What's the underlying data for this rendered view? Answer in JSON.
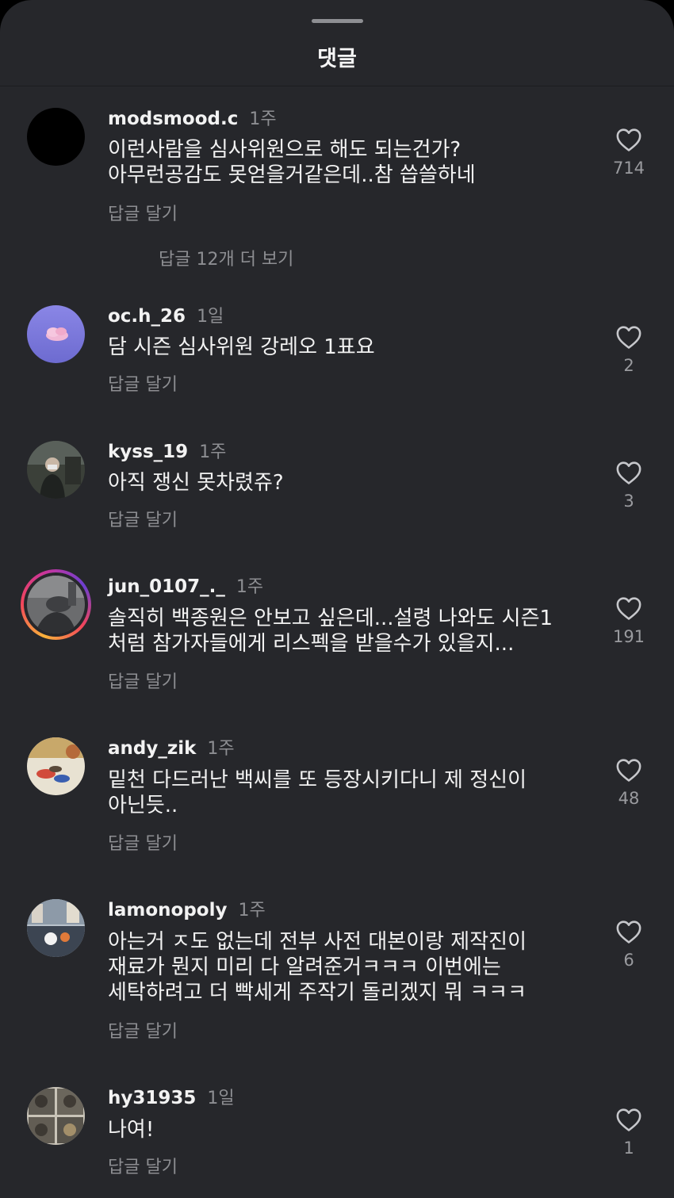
{
  "sheet": {
    "title": "댓글"
  },
  "comments": [
    {
      "username": "modsmood.c",
      "time": "1주",
      "text": "이런사람을 심사위원으로 해도 되는건가?\n아무런공감도 못얻을거같은데..참 씁쓸하네",
      "reply_label": "답글 달기",
      "likes": "714",
      "view_replies": "답글 12개 더 보기"
    },
    {
      "username": "oc.h_26",
      "time": "1일",
      "text": "담 시즌 심사위원 강레오 1표요",
      "reply_label": "답글 달기",
      "likes": "2"
    },
    {
      "username": "kyss_19",
      "time": "1주",
      "text": "아직 쟁신 못차렸쥬?",
      "reply_label": "답글 달기",
      "likes": "3"
    },
    {
      "username": "jun_0107_._",
      "time": "1주",
      "text": "솔직히 백종원은 안보고 싶은데...설령 나와도 시즌1\n처럼 참가자들에게 리스펙을 받을수가 있을지...",
      "reply_label": "답글 달기",
      "likes": "191"
    },
    {
      "username": "andy_zik",
      "time": "1주",
      "text": "밑천 다드러난 백씨를 또 등장시키다니 제 정신이\n아닌듯..",
      "reply_label": "답글 달기",
      "likes": "48"
    },
    {
      "username": "lamonopoly",
      "time": "1주",
      "text": "아는거 ㅈ도 없는데 전부 사전 대본이랑 제작진이\n재료가 뭔지 미리 다 알려준거ㅋㅋㅋ 이번에는\n세탁하려고 더 빡세게 주작기 돌리겠지 뭐 ㅋㅋㅋ",
      "reply_label": "답글 달기",
      "likes": "6"
    },
    {
      "username": "hy31935",
      "time": "1일",
      "text": "나여!",
      "reply_label": "답글 달기",
      "likes": "1"
    }
  ]
}
